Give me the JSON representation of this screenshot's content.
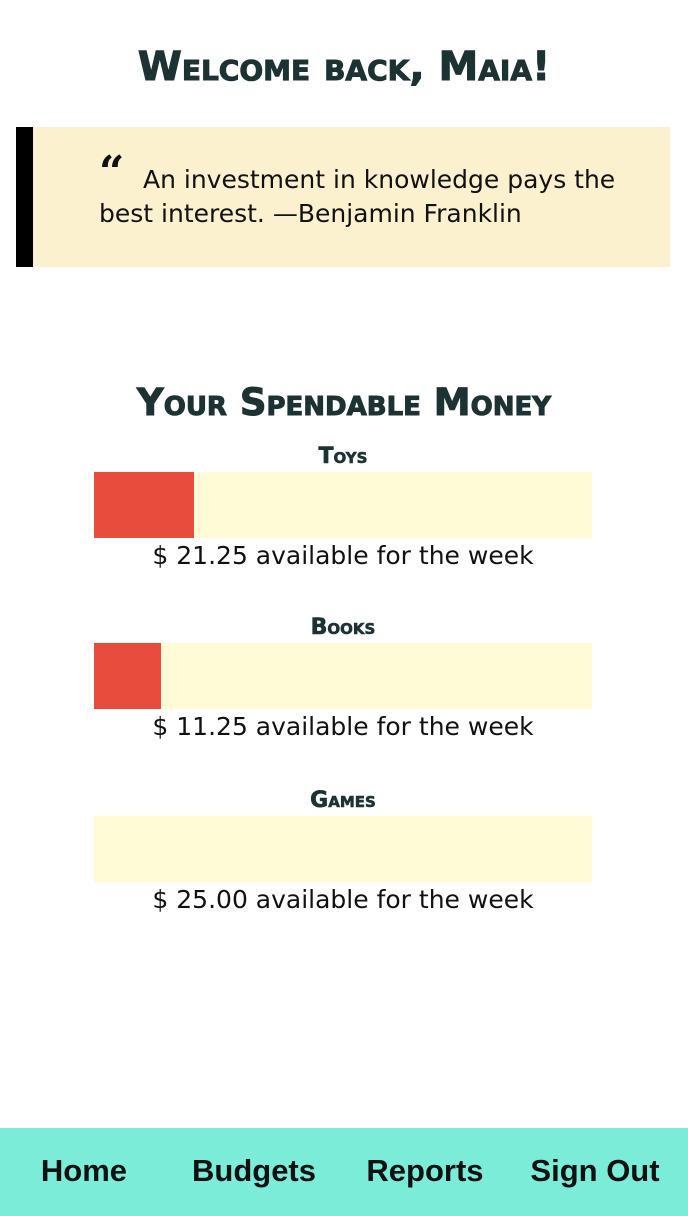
{
  "header": {
    "welcome": "Welcome back, Maia!"
  },
  "quote": {
    "mark": "“",
    "text": "An investment in knowledge pays the best interest. —Benjamin Franklin"
  },
  "spendable": {
    "title": "Your Spendable Money",
    "budgets": [
      {
        "name": "Toys",
        "amount_text": "$ 21.25 available for the week",
        "fill_fraction": 0.2
      },
      {
        "name": "Books",
        "amount_text": "$ 11.25 available for the week",
        "fill_fraction": 0.134
      },
      {
        "name": "Games",
        "amount_text": "$ 25.00 available for the week",
        "fill_fraction": 0.0
      }
    ]
  },
  "colors": {
    "bar_fill": "#e74c3c",
    "bar_track": "#fffbd6",
    "quote_bg": "#fbf1cf",
    "nav_bg": "#7aecd8",
    "heading": "#1d3233"
  },
  "nav": {
    "items": [
      {
        "label": "Home"
      },
      {
        "label": "Budgets"
      },
      {
        "label": "Reports"
      },
      {
        "label": "Sign Out"
      }
    ]
  }
}
